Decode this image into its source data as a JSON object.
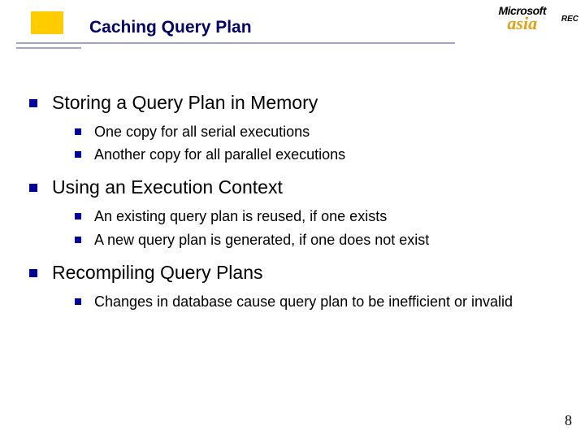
{
  "header": {
    "title": "Caching Query Plan",
    "logo_top": "Microsoft",
    "logo_bottom": "asia",
    "corner_tag": "REC"
  },
  "bullets": [
    {
      "text": "Storing a Query Plan in Memory",
      "subs": [
        "One copy for all serial executions",
        "Another copy for all parallel executions"
      ]
    },
    {
      "text": "Using an Execution Context",
      "subs": [
        "An existing query plan is reused, if one exists",
        "A new query plan is generated, if one does not exist"
      ]
    },
    {
      "text": "Recompiling Query Plans",
      "subs": [
        "Changes in database cause query plan to be inefficient or invalid"
      ]
    }
  ],
  "page_number": "8"
}
